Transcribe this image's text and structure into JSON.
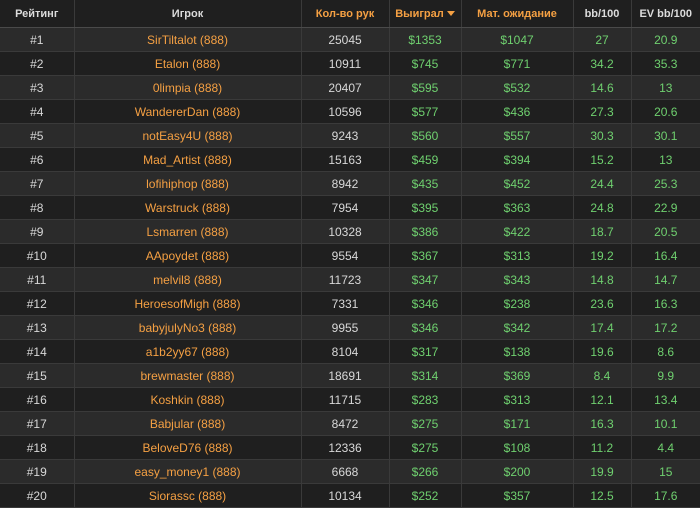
{
  "colors": {
    "background": "#1f1f1f",
    "row_alt": "#2b2b2b",
    "header_accent": "#f5a043",
    "player_name": "#f5a043",
    "money_green": "#6fd06f",
    "text": "#d8d8d8"
  },
  "headers": {
    "rank": "Рейтинг",
    "player": "Игрок",
    "hands": "Кол-во рук",
    "won": "Выиграл",
    "expected": "Мат. ожидание",
    "bb100": "bb/100",
    "ev_bb100": "EV bb/100"
  },
  "sort": {
    "column": "won",
    "icon": "caret-down-icon"
  },
  "rows": [
    {
      "rank": "#1",
      "player": "SirTiltalot (888)",
      "hands": "25045",
      "won": "$1353",
      "expected": "$1047",
      "bb100": "27",
      "ev_bb100": "20.9"
    },
    {
      "rank": "#2",
      "player": "Etalon (888)",
      "hands": "10911",
      "won": "$745",
      "expected": "$771",
      "bb100": "34.2",
      "ev_bb100": "35.3"
    },
    {
      "rank": "#3",
      "player": "0limpia (888)",
      "hands": "20407",
      "won": "$595",
      "expected": "$532",
      "bb100": "14.6",
      "ev_bb100": "13"
    },
    {
      "rank": "#4",
      "player": "WandererDan (888)",
      "hands": "10596",
      "won": "$577",
      "expected": "$436",
      "bb100": "27.3",
      "ev_bb100": "20.6"
    },
    {
      "rank": "#5",
      "player": "notEasy4U (888)",
      "hands": "9243",
      "won": "$560",
      "expected": "$557",
      "bb100": "30.3",
      "ev_bb100": "30.1"
    },
    {
      "rank": "#6",
      "player": "Mad_Artist (888)",
      "hands": "15163",
      "won": "$459",
      "expected": "$394",
      "bb100": "15.2",
      "ev_bb100": "13"
    },
    {
      "rank": "#7",
      "player": "lofihiphop (888)",
      "hands": "8942",
      "won": "$435",
      "expected": "$452",
      "bb100": "24.4",
      "ev_bb100": "25.3"
    },
    {
      "rank": "#8",
      "player": "Warstruck (888)",
      "hands": "7954",
      "won": "$395",
      "expected": "$363",
      "bb100": "24.8",
      "ev_bb100": "22.9"
    },
    {
      "rank": "#9",
      "player": "Lsmarren (888)",
      "hands": "10328",
      "won": "$386",
      "expected": "$422",
      "bb100": "18.7",
      "ev_bb100": "20.5"
    },
    {
      "rank": "#10",
      "player": "AApoydet (888)",
      "hands": "9554",
      "won": "$367",
      "expected": "$313",
      "bb100": "19.2",
      "ev_bb100": "16.4"
    },
    {
      "rank": "#11",
      "player": "melvil8 (888)",
      "hands": "11723",
      "won": "$347",
      "expected": "$343",
      "bb100": "14.8",
      "ev_bb100": "14.7"
    },
    {
      "rank": "#12",
      "player": "HeroesofMigh (888)",
      "hands": "7331",
      "won": "$346",
      "expected": "$238",
      "bb100": "23.6",
      "ev_bb100": "16.3"
    },
    {
      "rank": "#13",
      "player": "babyjulyNo3 (888)",
      "hands": "9955",
      "won": "$346",
      "expected": "$342",
      "bb100": "17.4",
      "ev_bb100": "17.2"
    },
    {
      "rank": "#14",
      "player": "a1b2yy67 (888)",
      "hands": "8104",
      "won": "$317",
      "expected": "$138",
      "bb100": "19.6",
      "ev_bb100": "8.6"
    },
    {
      "rank": "#15",
      "player": "brewmaster (888)",
      "hands": "18691",
      "won": "$314",
      "expected": "$369",
      "bb100": "8.4",
      "ev_bb100": "9.9"
    },
    {
      "rank": "#16",
      "player": "Koshkin (888)",
      "hands": "11715",
      "won": "$283",
      "expected": "$313",
      "bb100": "12.1",
      "ev_bb100": "13.4"
    },
    {
      "rank": "#17",
      "player": "Babjular (888)",
      "hands": "8472",
      "won": "$275",
      "expected": "$171",
      "bb100": "16.3",
      "ev_bb100": "10.1"
    },
    {
      "rank": "#18",
      "player": "BeloveD76 (888)",
      "hands": "12336",
      "won": "$275",
      "expected": "$108",
      "bb100": "11.2",
      "ev_bb100": "4.4"
    },
    {
      "rank": "#19",
      "player": "easy_money1 (888)",
      "hands": "6668",
      "won": "$266",
      "expected": "$200",
      "bb100": "19.9",
      "ev_bb100": "15"
    },
    {
      "rank": "#20",
      "player": "Siorassc (888)",
      "hands": "10134",
      "won": "$252",
      "expected": "$357",
      "bb100": "12.5",
      "ev_bb100": "17.6"
    }
  ]
}
